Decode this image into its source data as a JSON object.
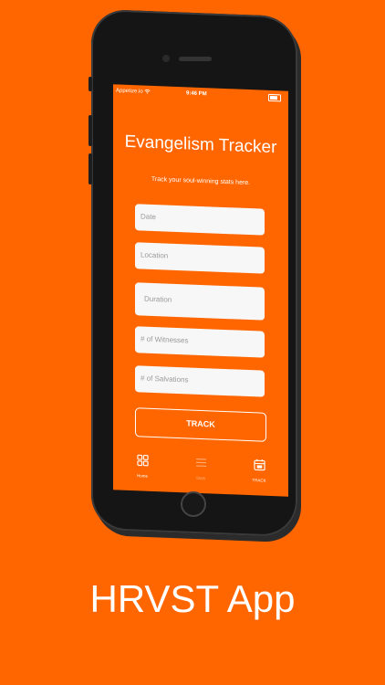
{
  "status_bar": {
    "carrier": "Appetize.io",
    "time": "9:46 PM"
  },
  "app": {
    "title": "Evangelism Tracker",
    "subtitle": "Track your soul-winning stats here."
  },
  "form": {
    "date_placeholder": "Date",
    "location_placeholder": "Location",
    "duration_placeholder": "Duration",
    "witnesses_placeholder": "# of Witnesses",
    "salvations_placeholder": "# of Salvations",
    "submit_label": "TRACK"
  },
  "tabbar": {
    "items": [
      {
        "label": "Home",
        "icon": "grid-icon"
      },
      {
        "label": "Stats",
        "icon": "list-icon"
      },
      {
        "label": "TRACK",
        "icon": "calendar-icon"
      }
    ]
  },
  "footer": {
    "title": "HRVST App"
  },
  "colors": {
    "background": "#ff6600",
    "field": "#f7f7f7"
  }
}
